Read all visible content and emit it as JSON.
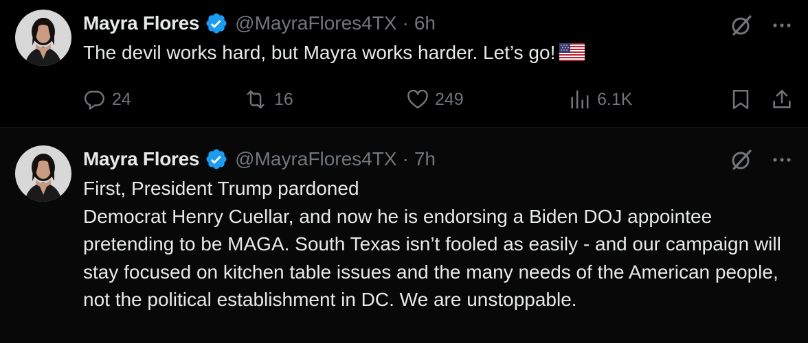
{
  "colors": {
    "background": "#000000",
    "text": "#e7e9ea",
    "muted": "#71767b",
    "verified": "#1d9bf0",
    "divider": "#2f3336"
  },
  "tweets": [
    {
      "author": "Mayra Flores",
      "handle": "@MayraFlores4TX",
      "separator": "·",
      "time": "6h",
      "text": "The devil works hard, but Mayra works harder. Let’s go!",
      "emoji": "us-flag",
      "metrics": {
        "replies": "24",
        "reposts": "16",
        "likes": "249",
        "views": "6.1K"
      }
    },
    {
      "author": "Mayra Flores",
      "handle": "@MayraFlores4TX",
      "separator": "·",
      "time": "7h",
      "text": "First, President Trump pardoned\nDemocrat Henry Cuellar, and now he is endorsing a Biden DOJ appointee pretending to be MAGA. South Texas isn’t fooled as easily - and our campaign will stay focused on kitchen table issues and the many needs of the American people, not the political establishment in DC. We are unstoppable."
    }
  ],
  "icons": {
    "verified": "verified-badge-icon",
    "grok": "grok-icon",
    "more": "more-icon",
    "reply": "reply-icon",
    "repost": "repost-icon",
    "like": "like-icon",
    "views": "views-icon",
    "bookmark": "bookmark-icon",
    "share": "share-icon"
  }
}
